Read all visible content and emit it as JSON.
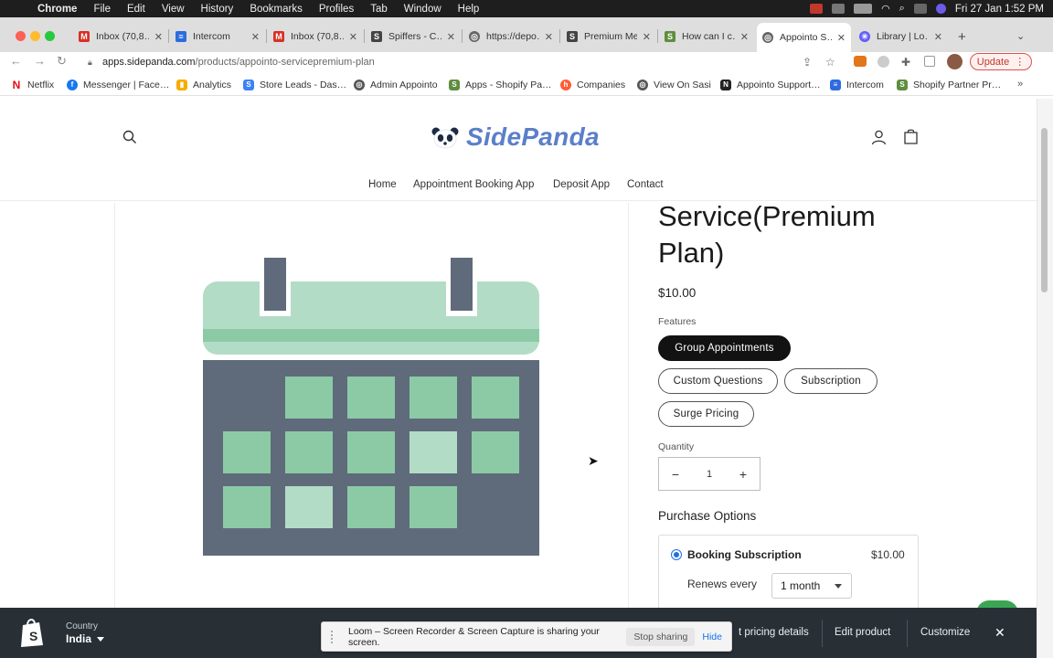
{
  "menubar": {
    "app_name": "Chrome",
    "items": [
      "File",
      "Edit",
      "View",
      "History",
      "Bookmarks",
      "Profiles",
      "Tab",
      "Window",
      "Help"
    ],
    "datetime": "Fri 27 Jan  1:52 PM"
  },
  "tabs": [
    {
      "label": "Inbox (70,8…",
      "icon": "gmail-icon",
      "color": "#d93025"
    },
    {
      "label": "Intercom",
      "icon": "intercom-icon",
      "color": "#2d6cdf"
    },
    {
      "label": "Inbox (70,8…",
      "icon": "gmail-icon",
      "color": "#d93025"
    },
    {
      "label": "Spiffers - C…",
      "icon": "spiff-icon",
      "color": "#444444"
    },
    {
      "label": "https://depo…",
      "icon": "globe-icon",
      "color": "#666666"
    },
    {
      "label": "Premium Me…",
      "icon": "spiff-icon",
      "color": "#444444"
    },
    {
      "label": "How can I c…",
      "icon": "shopify-icon",
      "color": "#5e8e3e"
    },
    {
      "label": "Appointo S…",
      "icon": "globe-icon",
      "color": "#666666"
    },
    {
      "label": "Library | Lo…",
      "icon": "loom-icon",
      "color": "#625df5"
    }
  ],
  "toolbar": {
    "url_host": "apps.sidepanda.com",
    "url_path": "/products/appointo-servicepremium-plan",
    "update_label": "Update"
  },
  "bookmarks": [
    {
      "label": "Netflix",
      "icon": "netflix-icon",
      "color": "#e50914"
    },
    {
      "label": "Messenger | Face…",
      "icon": "facebook-icon",
      "color": "#1877f2"
    },
    {
      "label": "Analytics",
      "icon": "analytics-icon",
      "color": "#f9ab00"
    },
    {
      "label": "Store Leads - Das…",
      "icon": "storeleads-icon",
      "color": "#3b82f6"
    },
    {
      "label": "Admin Appointo",
      "icon": "globe-icon",
      "color": "#555555"
    },
    {
      "label": "Apps - Shopify Pa…",
      "icon": "shopify-icon",
      "color": "#5e8e3e"
    },
    {
      "label": "Companies",
      "icon": "hubspot-icon",
      "color": "#ff5c35"
    },
    {
      "label": "View On Sasi",
      "icon": "globe-icon",
      "color": "#555555"
    },
    {
      "label": "Appointo Support…",
      "icon": "notion-icon",
      "color": "#222222"
    },
    {
      "label": "Intercom",
      "icon": "intercom-icon",
      "color": "#2d6cdf"
    },
    {
      "label": "Shopify Partner Pr…",
      "icon": "shopify-icon",
      "color": "#5e8e3e"
    }
  ],
  "store": {
    "logo_text": "SidePanda",
    "nav": [
      "Home",
      "Appointment Booking App",
      "Deposit App",
      "Contact"
    ]
  },
  "product": {
    "title_line1": "Service(Premium",
    "title_line2": "Plan)",
    "price": "$10.00",
    "features_label": "Features",
    "features": [
      "Group Appointments",
      "Custom Questions",
      "Subscription",
      "Surge Pricing"
    ],
    "selected_feature": "Group Appointments",
    "quantity_label": "Quantity",
    "quantity": "1",
    "purchase_label": "Purchase Options",
    "plan_name": "Booking Subscription",
    "plan_price": "$10.00",
    "renews_label": "Renews every",
    "renews_value": "1 month"
  },
  "preview_bar": {
    "country_label": "Country",
    "country_value": "India",
    "pricing_details": "t pricing details",
    "edit_product": "Edit product",
    "customize": "Customize"
  },
  "loom": {
    "message": "Loom – Screen Recorder & Screen Capture is sharing your screen.",
    "stop_label": "Stop sharing",
    "hide_label": "Hide"
  },
  "colors": {
    "brand_blue": "#5b7fc9",
    "calendar_green": "#8ccaa6",
    "calendar_light": "#b3dcc7",
    "calendar_slate": "#5f6b7a"
  }
}
